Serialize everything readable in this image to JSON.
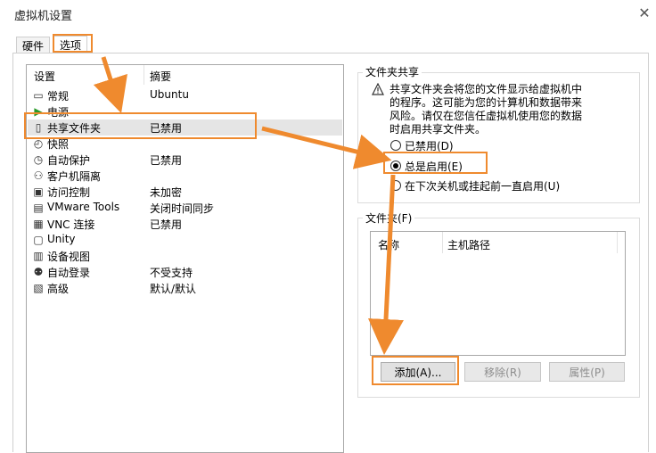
{
  "window": {
    "title": "虚拟机设置"
  },
  "tabs": [
    {
      "label": "硬件",
      "active": false
    },
    {
      "label": "选项",
      "active": true
    }
  ],
  "settings_list": {
    "col_setting": "设置",
    "col_summary": "摘要",
    "items": [
      {
        "name": "常规",
        "summary": "Ubuntu",
        "icon": "general-icon"
      },
      {
        "name": "电源",
        "summary": "",
        "icon": "power-icon"
      },
      {
        "name": "共享文件夹",
        "summary": "已禁用",
        "icon": "shared-folder-icon",
        "selected": true
      },
      {
        "name": "快照",
        "summary": "",
        "icon": "snapshot-icon"
      },
      {
        "name": "自动保护",
        "summary": "已禁用",
        "icon": "autoprotect-icon"
      },
      {
        "name": "客户机隔离",
        "summary": "",
        "icon": "isolation-icon"
      },
      {
        "name": "访问控制",
        "summary": "未加密",
        "icon": "access-control-icon"
      },
      {
        "name": "VMware Tools",
        "summary": "关闭时间同步",
        "icon": "vmware-tools-icon"
      },
      {
        "name": "VNC 连接",
        "summary": "已禁用",
        "icon": "vnc-icon"
      },
      {
        "name": "Unity",
        "summary": "",
        "icon": "unity-icon"
      },
      {
        "name": "设备视图",
        "summary": "",
        "icon": "device-view-icon"
      },
      {
        "name": "自动登录",
        "summary": "不受支持",
        "icon": "autologin-icon"
      },
      {
        "name": "高级",
        "summary": "默认/默认",
        "icon": "advanced-icon"
      }
    ]
  },
  "folder_sharing": {
    "label": "文件夹共享",
    "warning_lines": [
      "共享文件夹会将您的文件显示给虚拟机中",
      "的程序。这可能为您的计算机和数据带来",
      "风险。请仅在您信任虚拟机使用您的数据",
      "时启用共享文件夹。"
    ],
    "warning_icon": "warning-icon",
    "options": [
      {
        "label": "已禁用(D)",
        "checked": false
      },
      {
        "label": "总是启用(E)",
        "checked": true
      },
      {
        "label": "在下次关机或挂起前一直启用(U)",
        "checked": false
      }
    ]
  },
  "folders": {
    "label": "文件夹(F)",
    "col_name": "名称",
    "col_path": "主机路径",
    "add_label": "添加(A)...",
    "remove_label": "移除(R)",
    "properties_label": "属性(P)"
  },
  "colors": {
    "highlight": "#ef8a2e",
    "selection": "#e5e5e5"
  }
}
